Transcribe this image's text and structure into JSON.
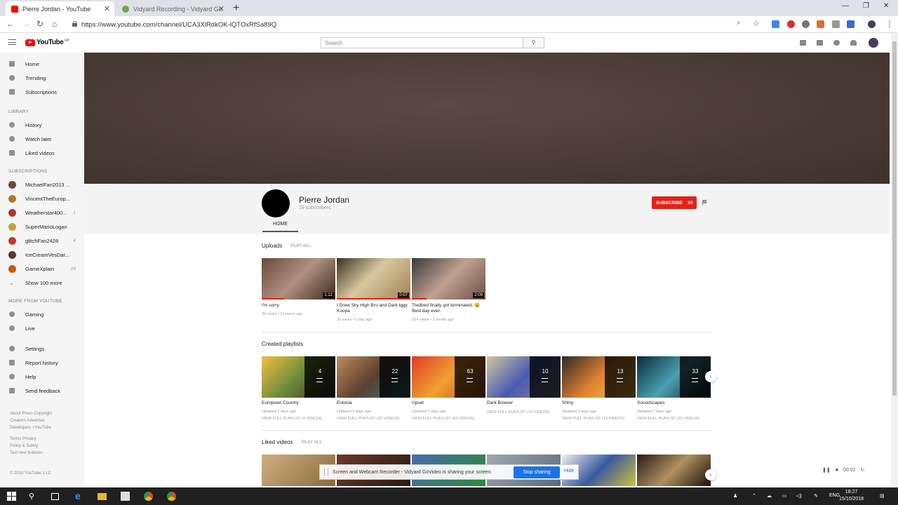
{
  "browser": {
    "tabs": [
      {
        "title": "Pierre Jordan - YouTube",
        "active": true
      },
      {
        "title": "Vidyard Recording - Vidyard Go",
        "active": false
      }
    ],
    "url": "https://www.youtube.com/channel/UCA3XlRdkOK-lQTOxRfSa89Q"
  },
  "masthead": {
    "logo_text": "YouTube",
    "logo_region": "GB",
    "search_placeholder": "Search"
  },
  "sidebar": {
    "main": [
      {
        "label": "Home",
        "icon": "home-icon"
      },
      {
        "label": "Trending",
        "icon": "flame-icon"
      },
      {
        "label": "Subscriptions",
        "icon": "subscriptions-icon"
      }
    ],
    "library_header": "LIBRARY",
    "library": [
      {
        "label": "History",
        "icon": "history-icon"
      },
      {
        "label": "Watch later",
        "icon": "clock-icon"
      },
      {
        "label": "Liked videos",
        "icon": "thumbs-up-icon"
      }
    ],
    "subscriptions_header": "SUBSCRIPTIONS",
    "subscriptions": [
      {
        "label": "MichaelFan2013 ...",
        "count": "",
        "color": "#6a4a3a"
      },
      {
        "label": "VincentTheEurop...",
        "count": "",
        "color": "#b07a2a"
      },
      {
        "label": "Weatherstar400...",
        "count": "1",
        "color": "#a33a2a"
      },
      {
        "label": "SuperMarioLogan",
        "count": "",
        "color": "#c8a040"
      },
      {
        "label": "glitchFan2428",
        "count": "4",
        "color": "#c0392b"
      },
      {
        "label": "IceCreamVesDar...",
        "count": "",
        "color": "#5a3a2a"
      },
      {
        "label": "GameXplain",
        "count": "29",
        "color": "#d35400"
      }
    ],
    "show_more": "Show 100 more",
    "more_header": "MORE FROM YOUTUBE",
    "more": [
      {
        "label": "Gaming",
        "icon": "gaming-icon"
      },
      {
        "label": "Live",
        "icon": "live-icon"
      }
    ],
    "settings": [
      {
        "label": "Settings",
        "icon": "gear-icon"
      },
      {
        "label": "Report history",
        "icon": "flag-icon"
      },
      {
        "label": "Help",
        "icon": "help-icon"
      },
      {
        "label": "Send feedback",
        "icon": "feedback-icon"
      }
    ],
    "footer_links_1": "About  Press  Copyright",
    "footer_links_2": "Creators  Advertise",
    "footer_links_3": "Developers  +YouTube",
    "footer_links_4": "Terms  Privacy",
    "footer_links_5": "Policy & Safety",
    "footer_links_6": "Test new features",
    "copyright": "© 2018 YouTube, LLC"
  },
  "channel": {
    "name": "Pierre Jordan",
    "subscribers": "19 subscribers",
    "subscribe_label": "SUBSCRIBE",
    "subscribe_count": "19",
    "tab_home": "HOME"
  },
  "uploads": {
    "title": "Uploads",
    "play_all": "PLAY ALL",
    "videos": [
      {
        "title": "I'm sorry.",
        "meta": "29 views • 21 hours ago",
        "duration": "1:12",
        "bg": "#8a6a5a",
        "watched": 0.3
      },
      {
        "title": "I Drew Sky High Bro and Dark Iggy Koopa",
        "meta": "33 views • 1 day ago",
        "duration": "0:07",
        "bg": "#c9b38a",
        "watched": 1.0
      },
      {
        "title": "Tredbed finally got terminated. 😀 Best day ever.",
        "meta": "324 views • 1 month ago",
        "duration": "2:09",
        "bg": "#9a7a6a",
        "watched": 0.2
      }
    ]
  },
  "playlists": {
    "title": "Created playlists",
    "items": [
      {
        "title": "European Country",
        "updated": "Updated 3 days ago",
        "view": "VIEW FULL PLAYLIST (4 VIDEOS)",
        "count": "4",
        "bg": "#d9a441"
      },
      {
        "title": "Estonia",
        "updated": "Updated 6 days ago",
        "view": "VIEW FULL PLAYLIST (22 VIDEOS)",
        "count": "22",
        "bg": "#9c6b4a"
      },
      {
        "title": "Upset",
        "updated": "Updated 7 days ago",
        "view": "VIEW FULL PLAYLIST (63 VIDEOS)",
        "count": "63",
        "bg": "#d04a2a"
      },
      {
        "title": "Dark Bowser",
        "updated": "",
        "view": "VIEW FULL PLAYLIST (10 VIDEOS)",
        "count": "10",
        "bg": "#8a8aa0"
      },
      {
        "title": "Shiny",
        "updated": "Updated 3 days ago",
        "view": "VIEW FULL PLAYLIST (13 VIDEOS)",
        "count": "13",
        "bg": "#c07030"
      },
      {
        "title": "Soundscapes",
        "updated": "Updated 7 days ago",
        "view": "VIEW FULL PLAYLIST (33 VIDEOS)",
        "count": "33",
        "bg": "#2a6a7a"
      }
    ]
  },
  "liked": {
    "title": "Liked videos",
    "play_all": "PLAY ALL",
    "thumbs": [
      "#b89a6a",
      "#6a3a2a",
      "#4a6ab0",
      "#a0a8b0",
      "#3a5aa0",
      "#2a1a14"
    ]
  },
  "recorder": {
    "message": "Screen and Webcam Recorder - Vidyard GoVideo is sharing your screen.",
    "stop": "Stop sharing",
    "hide": "Hide",
    "timer": "00:02"
  },
  "taskbar": {
    "lang": "ENG",
    "time": "18:27",
    "date": "15/10/2018"
  }
}
